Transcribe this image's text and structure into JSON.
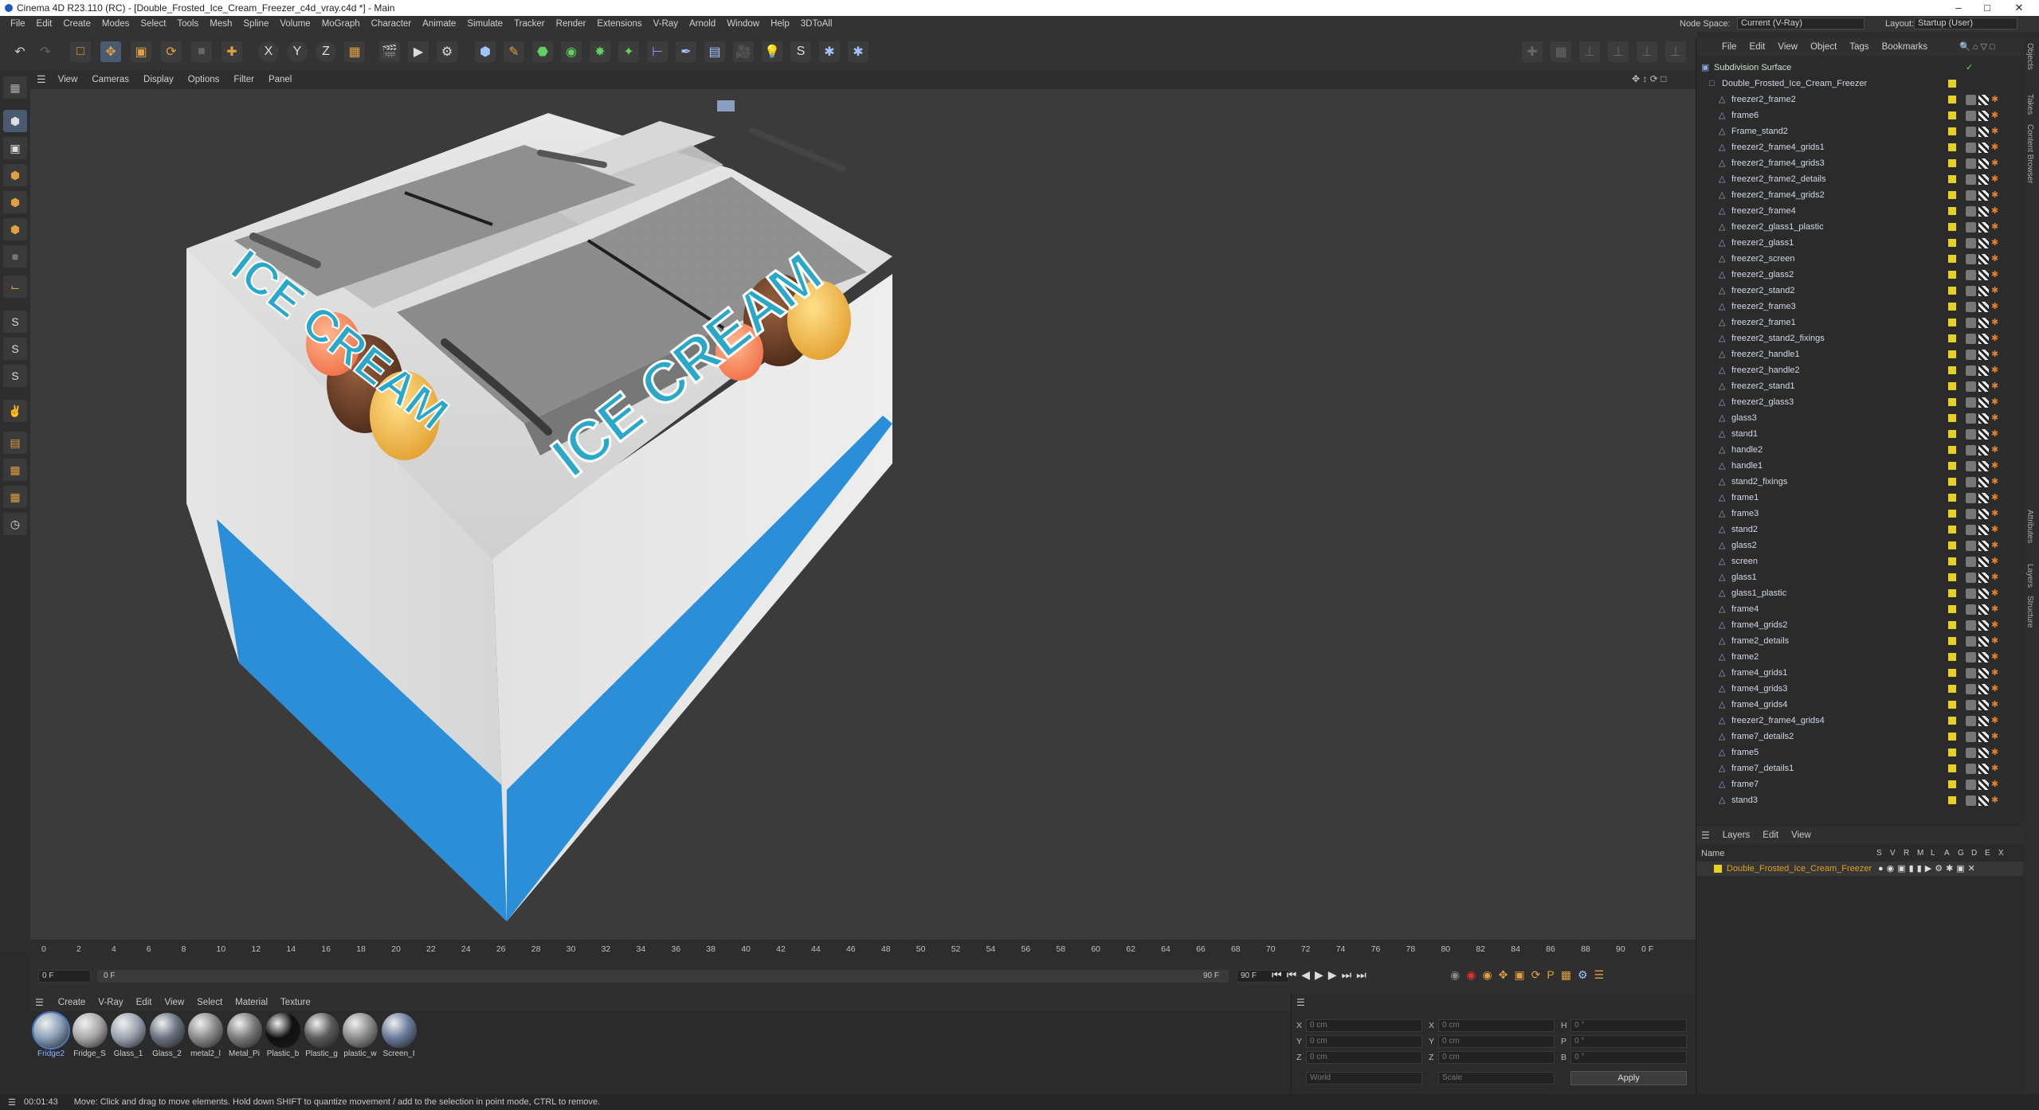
{
  "window": {
    "title": "Cinema 4D R23.110 (RC) - [Double_Frosted_Ice_Cream_Freezer_c4d_vray.c4d *] - Main"
  },
  "menu": [
    "File",
    "Edit",
    "Create",
    "Modes",
    "Select",
    "Tools",
    "Mesh",
    "Spline",
    "Volume",
    "MoGraph",
    "Character",
    "Animate",
    "Simulate",
    "Tracker",
    "Render",
    "Extensions",
    "V-Ray",
    "Arnold",
    "Window",
    "Help",
    "3DToAll"
  ],
  "node_space": {
    "label": "Node Space:",
    "value": "Current (V-Ray)"
  },
  "layout": {
    "label": "Layout:",
    "value": "Startup (User)"
  },
  "viewport_menu": [
    "View",
    "Cameras",
    "Display",
    "Options",
    "Filter",
    "Panel"
  ],
  "model_text": {
    "left": "ICE CREAM",
    "right": "ICE CREAM"
  },
  "object_menu": [
    "File",
    "Edit",
    "View",
    "Object",
    "Tags",
    "Bookmarks"
  ],
  "objects": {
    "root": "Subdivision Surface",
    "group": "Double_Frosted_Ice_Cream_Freezer",
    "children": [
      "freezer2_frame2",
      "frame6",
      "Frame_stand2",
      "freezer2_frame4_grids1",
      "freezer2_frame4_grids3",
      "freezer2_frame2_details",
      "freezer2_frame4_grids2",
      "freezer2_frame4",
      "freezer2_glass1_plastic",
      "freezer2_glass1",
      "freezer2_screen",
      "freezer2_glass2",
      "freezer2_stand2",
      "freezer2_frame3",
      "freezer2_frame1",
      "freezer2_stand2_fixings",
      "freezer2_handle1",
      "freezer2_handle2",
      "freezer2_stand1",
      "freezer2_glass3",
      "glass3",
      "stand1",
      "handle2",
      "handle1",
      "stand2_fixings",
      "frame1",
      "frame3",
      "stand2",
      "glass2",
      "screen",
      "glass1",
      "glass1_plastic",
      "frame4",
      "frame4_grids2",
      "frame2_details",
      "frame2",
      "frame4_grids1",
      "frame4_grids3",
      "frame4_grids4",
      "freezer2_frame4_grids4",
      "frame7_details2",
      "frame5",
      "frame7_details1",
      "frame7",
      "stand3"
    ]
  },
  "layers_menu": [
    "Layers",
    "Edit",
    "View"
  ],
  "layers": {
    "name_header": "Name",
    "flags": [
      "S",
      "V",
      "R",
      "M",
      "L",
      "A",
      "G",
      "D",
      "E",
      "X"
    ],
    "items": [
      "Double_Frosted_Ice_Cream_Freezer"
    ]
  },
  "timeline": {
    "ticks": [
      "0",
      "2",
      "4",
      "6",
      "8",
      "10",
      "12",
      "14",
      "16",
      "18",
      "20",
      "22",
      "24",
      "26",
      "28",
      "30",
      "32",
      "34",
      "36",
      "38",
      "40",
      "42",
      "44",
      "46",
      "48",
      "50",
      "52",
      "54",
      "56",
      "58",
      "60",
      "62",
      "64",
      "66",
      "68",
      "70",
      "72",
      "74",
      "76",
      "78",
      "80",
      "82",
      "84",
      "86",
      "88",
      "90"
    ],
    "current_frame": "0 F",
    "start_frame": "0 F",
    "range_start": "0 F",
    "range_end": "90 F",
    "end_frame": "90 F"
  },
  "material_menu": [
    "Create",
    "V-Ray",
    "Edit",
    "View",
    "Select",
    "Material",
    "Texture"
  ],
  "materials": [
    "Fridge2",
    "Fridge_S",
    "Glass_1",
    "Glass_2",
    "metal2_l",
    "Metal_Pi",
    "Plastic_b",
    "Plastic_g",
    "plastic_w",
    "Screen_I"
  ],
  "coordinates": {
    "labels_pos": [
      "X",
      "Y",
      "Z"
    ],
    "labels_size": [
      "X",
      "Y",
      "Z"
    ],
    "labels_rot": [
      "H",
      "P",
      "B"
    ],
    "pos_values": [
      "0 cm",
      "0 cm",
      "0 cm"
    ],
    "size_values": [
      "0 cm",
      "0 cm",
      "0 cm"
    ],
    "rot_values": [
      "0 °",
      "0 °",
      "0 °"
    ],
    "mode1": "World",
    "mode2": "Scale",
    "apply": "Apply"
  },
  "right_tabs": [
    "Objects",
    "Takes",
    "Content Browser",
    "Attributes",
    "Layers",
    "Structure"
  ],
  "status": {
    "time": "00:01:43",
    "message": "Move: Click and drag to move elements. Hold down SHIFT to quantize movement / add to the selection in point mode, CTRL to remove."
  }
}
